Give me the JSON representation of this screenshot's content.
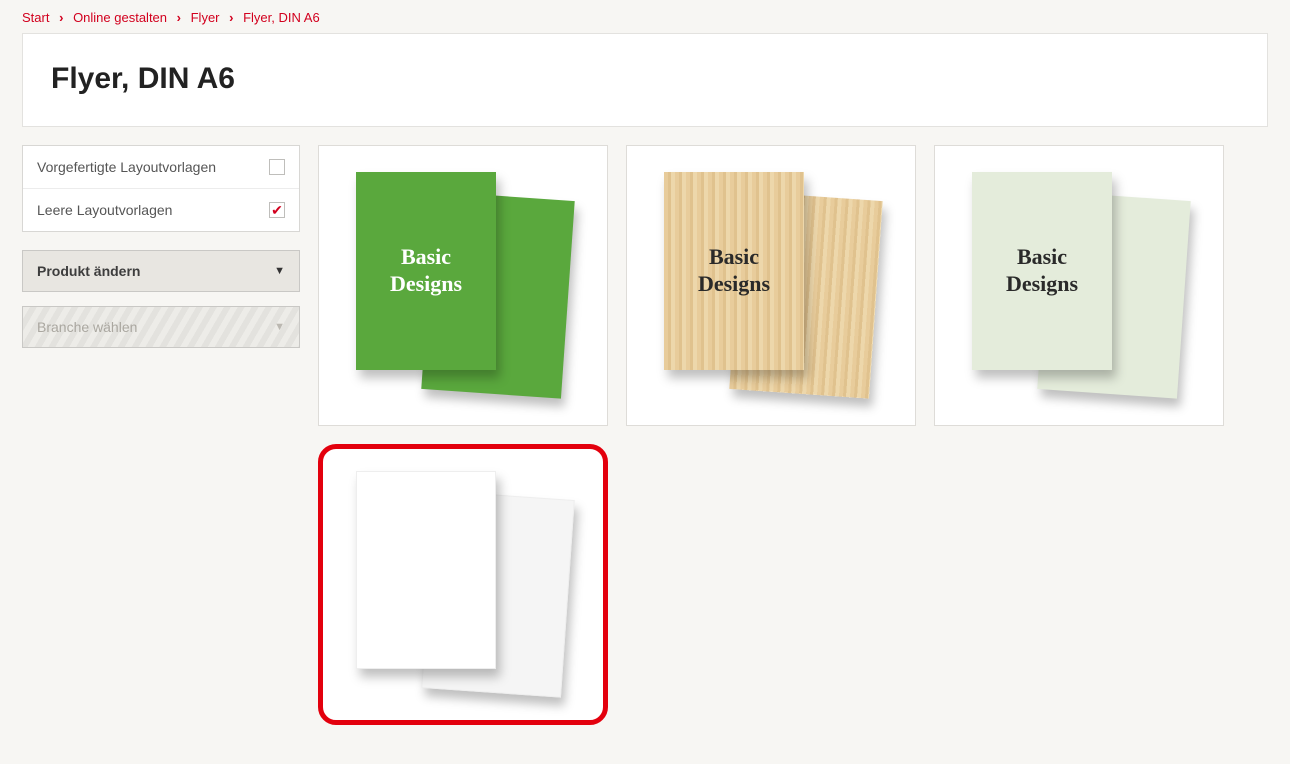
{
  "breadcrumb": {
    "items": [
      "Start",
      "Online gestalten",
      "Flyer",
      "Flyer, DIN A6"
    ]
  },
  "page": {
    "title": "Flyer, DIN A6"
  },
  "sidebar": {
    "filters": [
      {
        "label": "Vorgefertigte Layoutvorlagen",
        "checked": false
      },
      {
        "label": "Leere Layoutvorlagen",
        "checked": true
      }
    ],
    "product_dropdown": "Produkt ändern",
    "branch_dropdown": "Branche wählen"
  },
  "cards": [
    {
      "variant": "green",
      "label1": "Basic",
      "label2": "Designs"
    },
    {
      "variant": "wood",
      "label1": "Basic",
      "label2": "Designs"
    },
    {
      "variant": "pale",
      "label1": "Basic",
      "label2": "Designs"
    },
    {
      "variant": "white",
      "label1": "",
      "label2": "",
      "highlighted": true
    }
  ]
}
